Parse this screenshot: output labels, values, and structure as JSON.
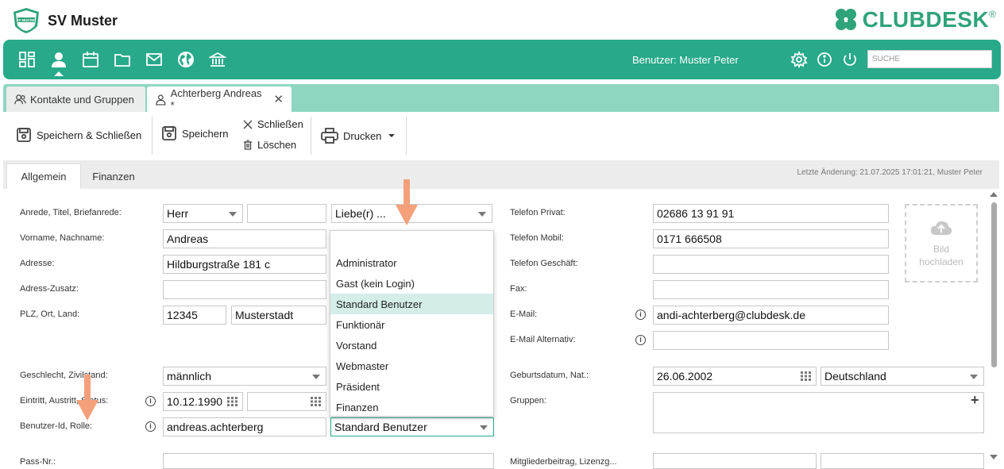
{
  "header": {
    "club_logo_icon": "shield-logo-icon",
    "club_logo_text": "SV MUSTER",
    "club_name": "SV Muster",
    "brand": "CLUBDESK",
    "brand_reg": "®",
    "brand_color": "#2fa37a"
  },
  "nav": {
    "color": "#27a98a",
    "icons": [
      "dashboard-icon",
      "person-icon",
      "calendar-icon",
      "folder-icon",
      "mail-icon",
      "globe-icon",
      "bank-icon"
    ],
    "user_label": "Benutzer: Muster Peter",
    "search_placeholder": "SUCHE",
    "right_icons": [
      "gear-icon",
      "info-icon",
      "power-icon"
    ]
  },
  "tabs": [
    {
      "label": "Kontakte und Gruppen",
      "icon": "group-icon"
    },
    {
      "label": "Achterberg Andreas *",
      "icon": "person-outline-icon",
      "close": "✕"
    }
  ],
  "toolbar": {
    "save_close": "Speichern & Schließen",
    "save": "Speichern",
    "close": "Schließen",
    "delete": "Löschen",
    "print": "Drucken"
  },
  "section_tabs": {
    "general": "Allgemein",
    "finance": "Finanzen",
    "last_change": "Letzte Änderung: 21.07.2025 17:01:21, Muster Peter"
  },
  "labels": {
    "salutation": "Anrede, Titel, Briefanrede:",
    "name": "Vorname, Nachname:",
    "address": "Adresse:",
    "address_extra": "Adress-Zusatz:",
    "zip_city": "PLZ, Ort, Land:",
    "gender": "Geschlecht, Zivilstand:",
    "entry": "Eintritt, Austritt, Status:",
    "userid": "Benutzer-Id, Rolle:",
    "pass": "Pass-Nr.:",
    "phone_private": "Telefon Privat:",
    "phone_mobile": "Telefon Mobil:",
    "phone_business": "Telefon Geschäft:",
    "fax": "Fax:",
    "email": "E-Mail:",
    "email_alt": "E-Mail Alternativ:",
    "birth": "Geburtsdatum, Nat.:",
    "groups": "Gruppen:",
    "member_fee": "Mitgliederbeitrag, Lizenzg..."
  },
  "values": {
    "salutation": "Herr",
    "title": "",
    "letter_salutation": "Liebe(r) ...",
    "firstname": "Andreas",
    "street": "Hildburgstraße 181 c",
    "address_extra": "",
    "zip": "12345",
    "city": "Musterstadt",
    "gender": "männlich",
    "entry_date": "10.12.1990",
    "exit_date": "",
    "userid": "andreas.achterberg",
    "role": "Standard Benutzer",
    "pass": "",
    "phone_private": "02686 13 91 91",
    "phone_mobile": "0171 666508",
    "phone_business": "",
    "fax": "",
    "email": "andi-achterberg@clubdesk.de",
    "email_alt": "",
    "birthdate": "26.06.2002",
    "nationality": "Deutschland",
    "groups": "",
    "member_fee": ""
  },
  "role_dropdown": {
    "options": [
      "",
      "Administrator",
      "Gast (kein Login)",
      "Standard Benutzer",
      "Funktionär",
      "Vorstand",
      "Webmaster",
      "Präsident",
      "Finanzen"
    ],
    "selected": "Standard Benutzer",
    "highlight_color": "#d4ede8"
  },
  "upload": {
    "icon": "cloud-upload-icon",
    "line1": "Bild",
    "line2": "hochladen"
  },
  "annotation_color": "#f4a07a",
  "groups_add": "+"
}
